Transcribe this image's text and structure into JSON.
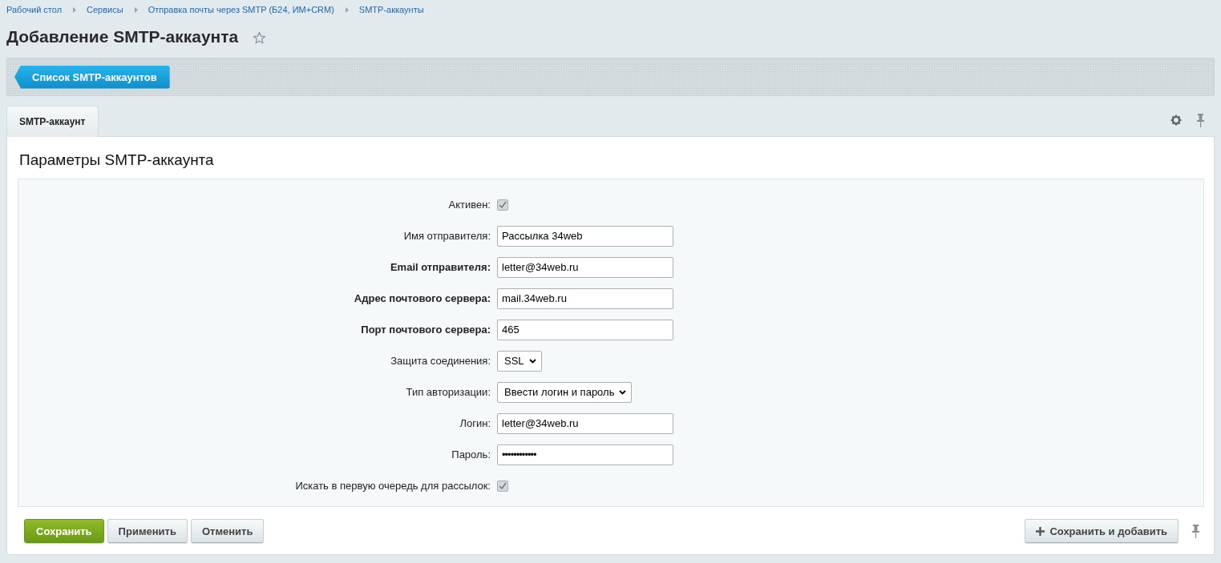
{
  "breadcrumbs": [
    "Рабочий стол",
    "Сервисы",
    "Отправка почты через SMTP (Б24, ИМ+CRM)",
    "SMTP-аккаунты"
  ],
  "title": "Добавление SMTP-аккаунта",
  "favorite": false,
  "toolbar": {
    "back_button": "Список SMTP-аккаунтов"
  },
  "tabs": [
    {
      "label": "SMTP-аккаунт",
      "selected": true
    }
  ],
  "section_title": "Параметры SMTP-аккаунта",
  "fields": [
    {
      "kind": "checkbox",
      "label": "Активен:",
      "required": false,
      "checked": true
    },
    {
      "kind": "text",
      "label": "Имя отправителя:",
      "required": false,
      "value": "Рассылка 34web"
    },
    {
      "kind": "text",
      "label": "Email отправителя:",
      "required": true,
      "value": "letter@34web.ru"
    },
    {
      "kind": "text",
      "label": "Адрес почтового сервера:",
      "required": true,
      "value": "mail.34web.ru"
    },
    {
      "kind": "text",
      "label": "Порт почтового сервера:",
      "required": true,
      "value": "465"
    },
    {
      "kind": "select",
      "label": "Защита соединения:",
      "required": false,
      "value": "SSL"
    },
    {
      "kind": "select",
      "label": "Тип авторизации:",
      "required": false,
      "value": "Ввести логин и пароль"
    },
    {
      "kind": "text",
      "label": "Логин:",
      "required": false,
      "value": "letter@34web.ru"
    },
    {
      "kind": "password",
      "label": "Пароль:",
      "required": false,
      "value": "••••••••••••"
    },
    {
      "kind": "checkbox",
      "label": "Искать в первую очередь для рассылок:",
      "required": false,
      "checked": true
    }
  ],
  "buttons": [
    {
      "label": "Сохранить",
      "kind": "primary"
    },
    {
      "label": "Применить",
      "kind": "normal"
    },
    {
      "label": "Отменить",
      "kind": "normal"
    }
  ],
  "extra_button": "Сохранить и добавить"
}
